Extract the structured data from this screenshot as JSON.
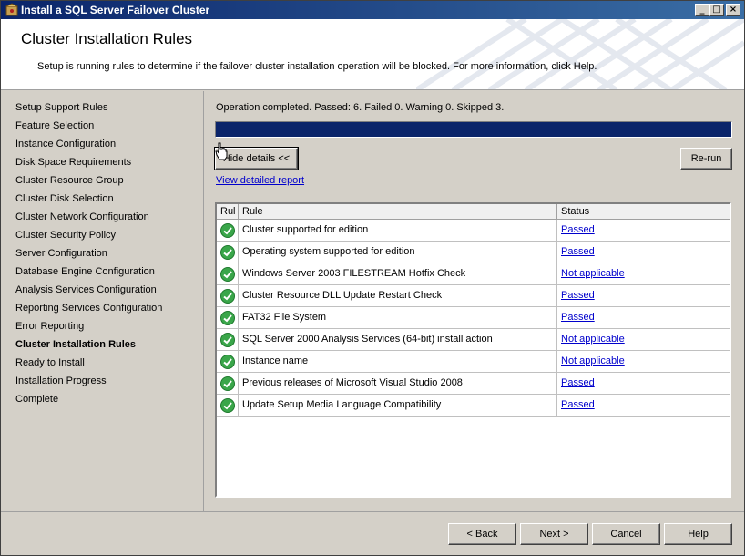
{
  "window": {
    "title": "Install a SQL Server Failover Cluster"
  },
  "header": {
    "title": "Cluster Installation Rules",
    "subtitle": "Setup is running rules to determine if the failover cluster installation operation will be blocked. For more information, click Help."
  },
  "sidebar": {
    "items": [
      {
        "label": "Setup Support Rules"
      },
      {
        "label": "Feature Selection"
      },
      {
        "label": "Instance Configuration"
      },
      {
        "label": "Disk Space Requirements"
      },
      {
        "label": "Cluster Resource Group"
      },
      {
        "label": "Cluster Disk Selection"
      },
      {
        "label": "Cluster Network Configuration"
      },
      {
        "label": "Cluster Security Policy"
      },
      {
        "label": "Server Configuration"
      },
      {
        "label": "Database Engine Configuration"
      },
      {
        "label": "Analysis Services Configuration"
      },
      {
        "label": "Reporting Services Configuration"
      },
      {
        "label": "Error Reporting"
      },
      {
        "label": "Cluster Installation Rules"
      },
      {
        "label": "Ready to Install"
      },
      {
        "label": "Installation Progress"
      },
      {
        "label": "Complete"
      }
    ]
  },
  "main": {
    "operation_status": "Operation completed. Passed: 6.   Failed 0.   Warning 0.   Skipped 3.",
    "progress_fraction": 1.0,
    "hide_details_label": "Hide details <<",
    "rerun_label": "Re-run",
    "view_report_label": "View detailed report",
    "grid": {
      "columns": {
        "icon": "Rul",
        "rule": "Rule",
        "status": "Status"
      },
      "rows": [
        {
          "rule": "Cluster supported for edition",
          "status": "Passed"
        },
        {
          "rule": "Operating system supported for edition",
          "status": "Passed"
        },
        {
          "rule": "Windows Server 2003 FILESTREAM Hotfix Check",
          "status": "Not applicable"
        },
        {
          "rule": "Cluster Resource DLL Update Restart Check",
          "status": "Passed"
        },
        {
          "rule": "FAT32 File System",
          "status": "Passed"
        },
        {
          "rule": "SQL Server 2000 Analysis Services (64-bit) install action",
          "status": "Not applicable"
        },
        {
          "rule": "Instance name",
          "status": "Not applicable"
        },
        {
          "rule": "Previous releases of Microsoft Visual Studio 2008",
          "status": "Passed"
        },
        {
          "rule": "Update Setup Media Language Compatibility",
          "status": "Passed"
        }
      ]
    }
  },
  "footer": {
    "back_label": "< Back",
    "next_label": "Next >",
    "cancel_label": "Cancel",
    "help_label": "Help"
  },
  "colors": {
    "passed_icon": "#3aa64a",
    "title_bar": "#0a246a",
    "progress_fill": "#0a246a",
    "link": "#0000cc"
  }
}
